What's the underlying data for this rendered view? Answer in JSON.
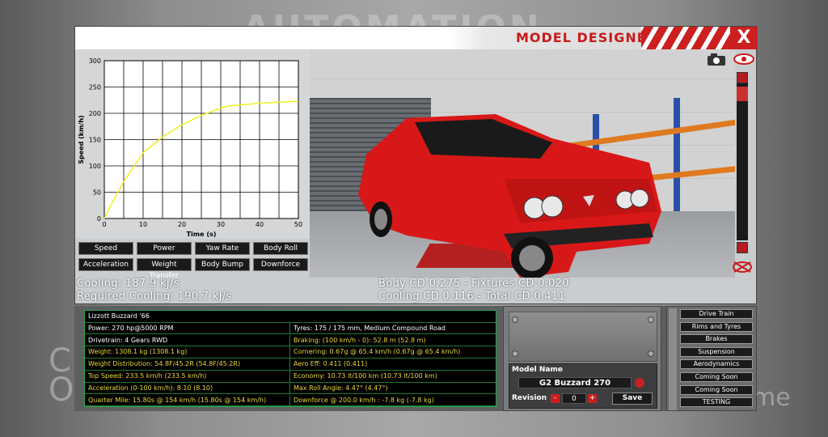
{
  "window": {
    "title": "MODEL DESIGNER",
    "close_label": "X"
  },
  "background": {
    "logo_text": "AUTOMATION",
    "left_text_1": "C",
    "left_text_2": "O",
    "right_text": "me"
  },
  "chart_data": {
    "type": "line",
    "xlabel": "Time (s)",
    "ylabel": "Speed (km/h)",
    "xlim": [
      0,
      50
    ],
    "ylim": [
      0,
      300
    ],
    "x_ticks": [
      0,
      10,
      20,
      30,
      40,
      50
    ],
    "y_ticks": [
      0,
      50,
      100,
      150,
      200,
      250,
      300
    ],
    "grid": true,
    "series": [
      {
        "color": "#f0f020",
        "x": [
          0,
          2,
          5,
          10,
          15,
          20,
          25,
          30,
          32,
          35,
          40,
          45,
          50
        ],
        "y": [
          0,
          30,
          70,
          125,
          155,
          178,
          196,
          210,
          214,
          216,
          219,
          221,
          223
        ]
      }
    ]
  },
  "graph_buttons": [
    "Speed",
    "Power",
    "Yaw Rate",
    "Body Roll",
    "Acceleration",
    "Weight Transfer",
    "Body Bump",
    "Downforce"
  ],
  "cooling": {
    "cooling": "Cooling: 187.9 kJ/s",
    "required": "Required Cooling: 190.7 kJ/s",
    "body_cd": "Body CD 0.275 - Fixtures CD 0.020",
    "cooling_cd": "Cooling CD 0.116 - Total CD 0.411"
  },
  "stats": {
    "title": "Lizzott Buzzard '66",
    "rows": [
      {
        "left": "Power: 270 hp@5000 RPM",
        "left_color": "white",
        "right": "Tyres: 175 / 175 mm, Medium Compound Road",
        "right_color": "white"
      },
      {
        "left": "Drivetrain: 4 Gears RWD",
        "left_color": "white",
        "right": "Braking: (100 km/h - 0): 52.8 m (52.8 m)",
        "right_color": "yellow"
      },
      {
        "left": "Weight: 1308.1 kg (1308.1 kg)",
        "left_color": "yellow",
        "right": "Cornering: 0.67g @ 65.4 km/h (0.67g @ 65.4 km/h)",
        "right_color": "yellow"
      },
      {
        "left": "Weight Distribution: 54.8F/45.2R (54.8F/45.2R)",
        "left_color": "yellow",
        "right": "Aero Eff: 0.411 (0.411)",
        "right_color": "yellow"
      },
      {
        "left": "Top Speed: 233.5 km/h (233.5 km/h)",
        "left_color": "yellow",
        "right": "Economy: 10.73 lt/100 km (10.73 lt/100 km)",
        "right_color": "yellow"
      },
      {
        "left": "Acceleration (0-100 km/h): 8.10 (8.10)",
        "left_color": "yellow",
        "right": "Max Roll Angle: 4.47° (4.47°)",
        "right_color": "yellow"
      },
      {
        "left": "Quarter Mile: 15.80s @ 154 km/h (15.80s @ 154 km/h)",
        "left_color": "yellow",
        "right": "Downforce @ 200.0 km/h : -7.8 kg (-7.8 kg)",
        "right_color": "yellow"
      }
    ]
  },
  "model": {
    "name_label": "Model Name",
    "name_value": "G2 Buzzard 270",
    "revision_label": "Revision",
    "revision_value": "0",
    "minus": "-",
    "plus": "+",
    "save_label": "Save"
  },
  "side_menu": [
    "Drive Train",
    "Rims and Tyres",
    "Brakes",
    "Suspension",
    "Aerodynamics",
    "Coming Soon",
    "Coming Soon",
    "TESTING"
  ],
  "colors": {
    "accent_red": "#c81a1a",
    "car_red": "#d81818",
    "stat_yellow": "#e8d838",
    "grid_green": "#2aa84a"
  }
}
